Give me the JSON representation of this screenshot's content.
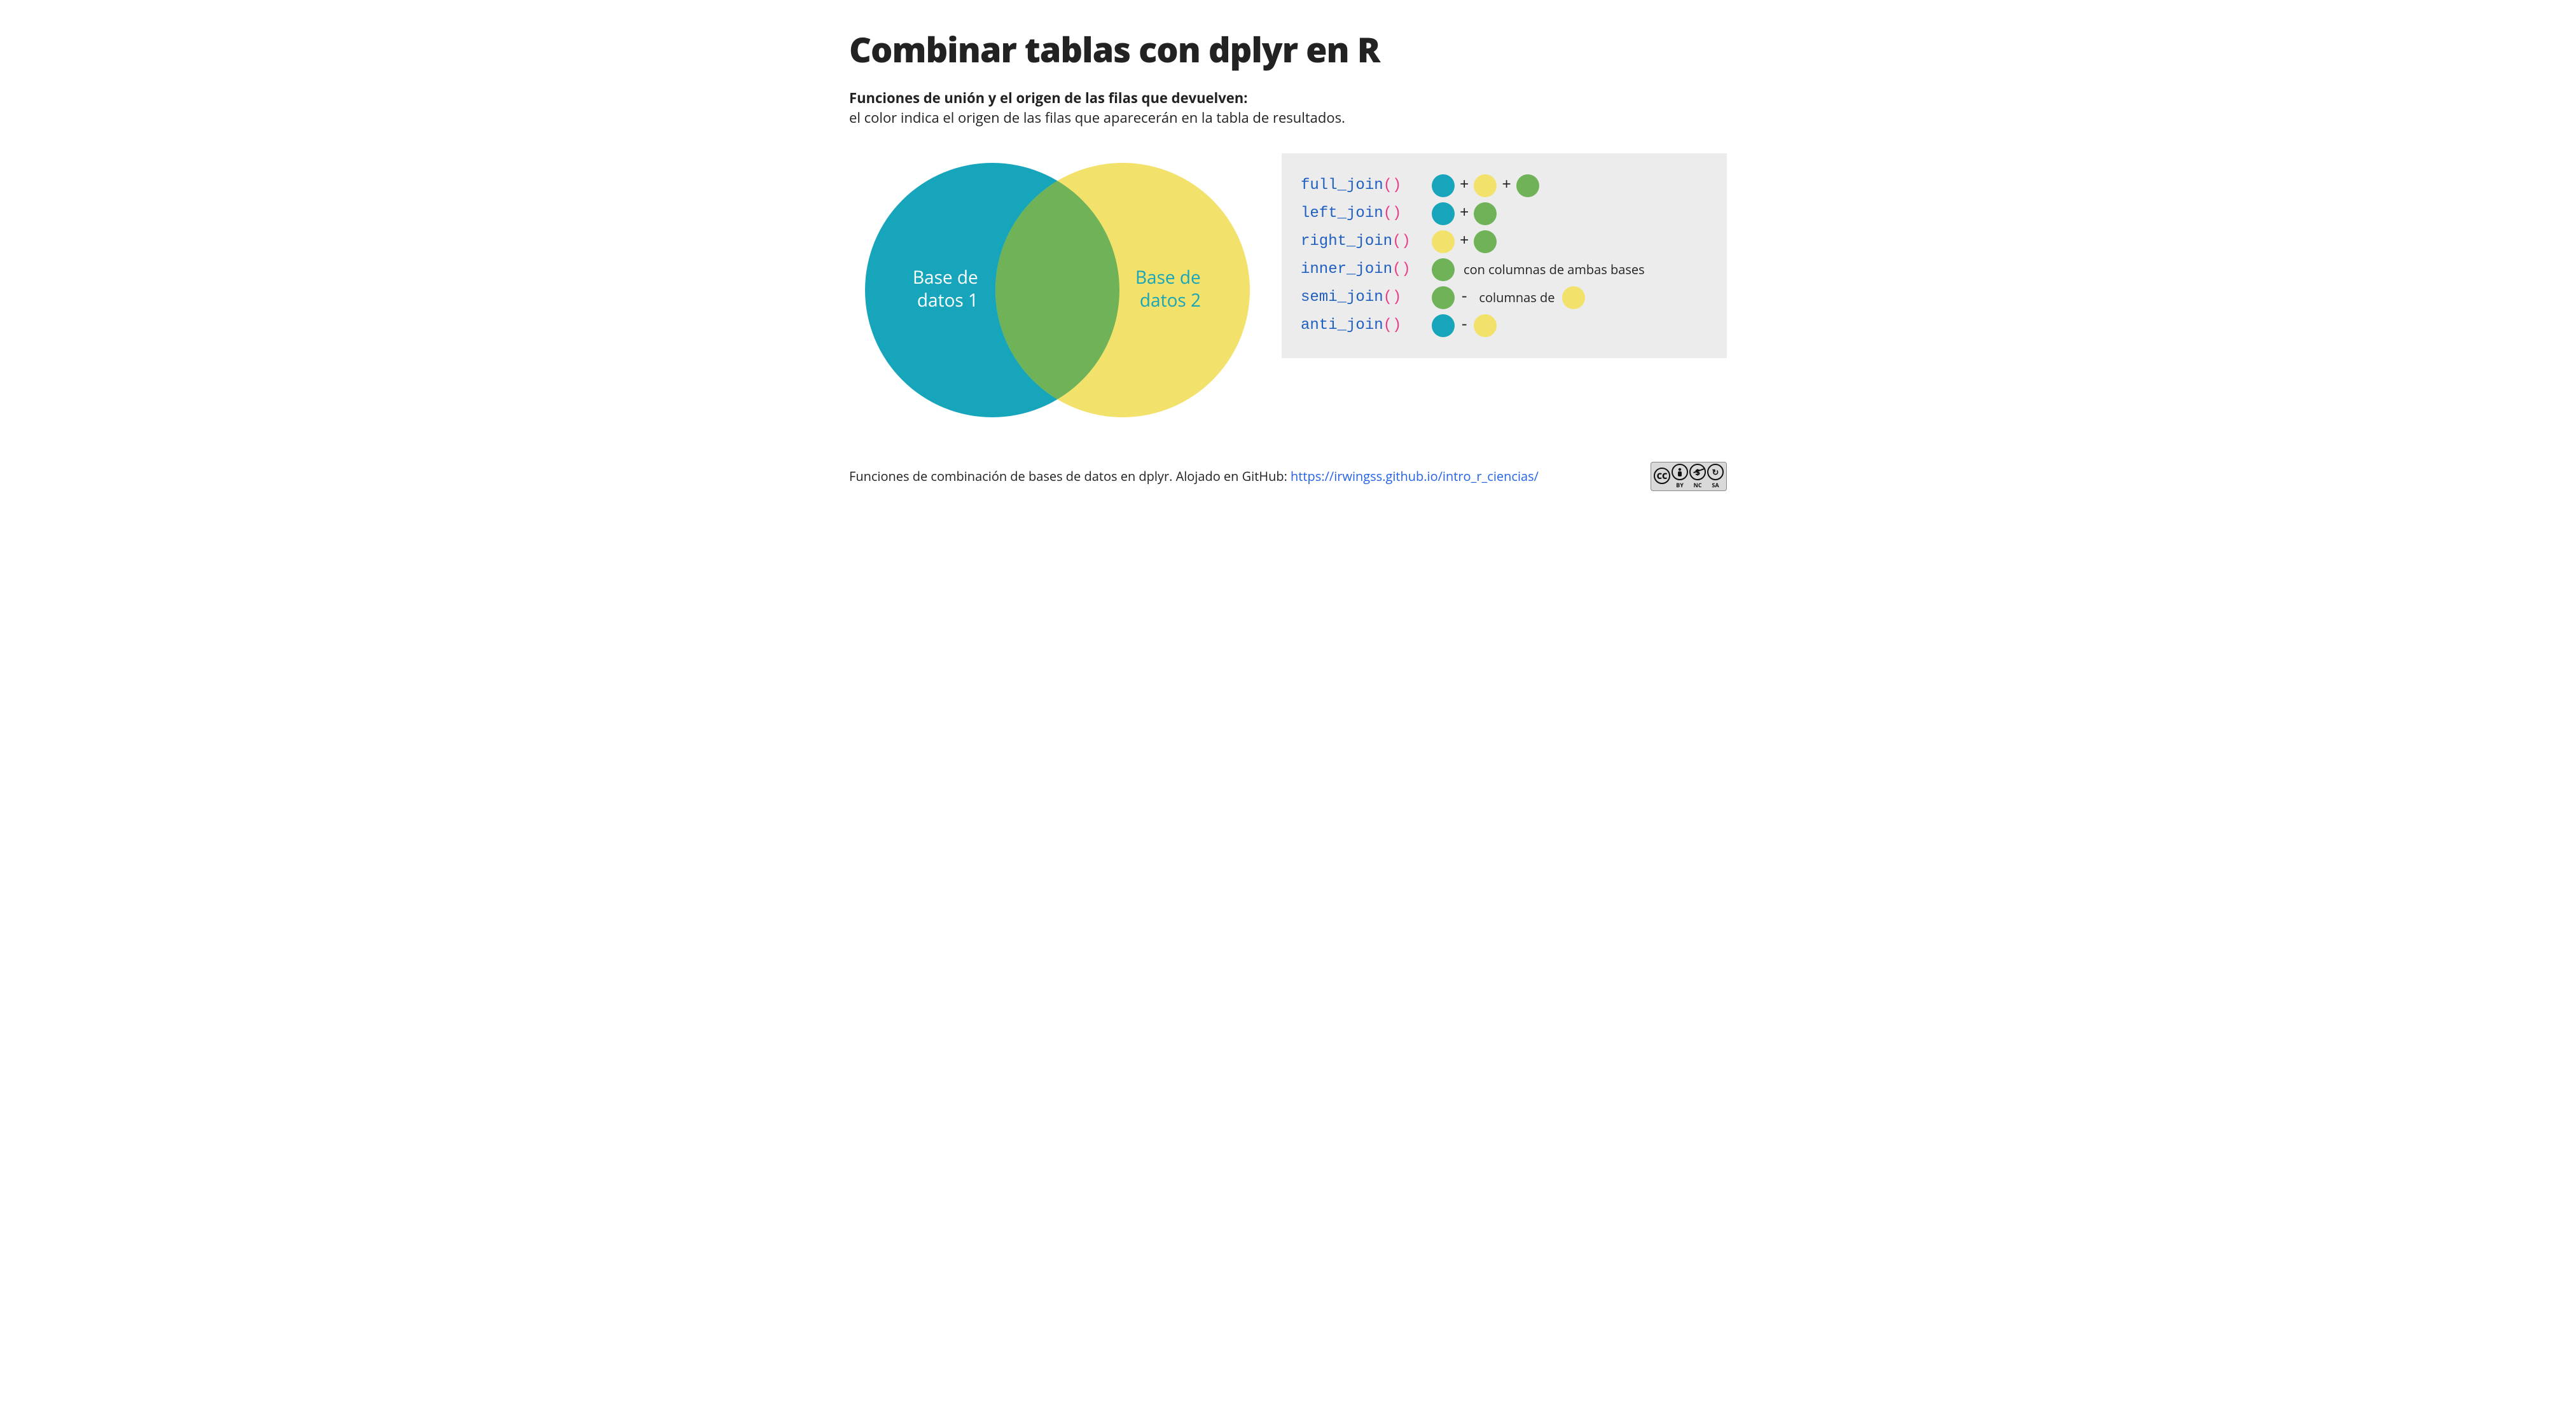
{
  "title": "Combinar tablas con dplyr en R",
  "subtitle_bold": "Funciones de unión y el origen de las filas que devuelven:",
  "subtitle_rest": "el color indica el origen de las filas que aparecerán en la tabla de resultados.",
  "venn": {
    "label1_line1": "Base de",
    "label1_line2": "datos 1",
    "label2_line1": "Base de",
    "label2_line2": "datos 2"
  },
  "colors": {
    "teal": "#17a5bb",
    "yellow": "#f2e16a",
    "green": "#6fb257",
    "code_fn": "#1f5fbf",
    "code_paren": "#e83e8c",
    "legend_bg": "#ececec",
    "link": "#2563eb"
  },
  "legend": [
    {
      "fn": "full_join",
      "tokens": [
        "teal",
        "+",
        "yellow",
        "+",
        "green"
      ]
    },
    {
      "fn": "left_join",
      "tokens": [
        "teal",
        "+",
        "green"
      ]
    },
    {
      "fn": "right_join",
      "tokens": [
        "yellow",
        "+",
        "green"
      ]
    },
    {
      "fn": "inner_join",
      "tokens": [
        "green"
      ],
      "note_after": "con columnas de ambas bases"
    },
    {
      "fn": "semi_join",
      "tokens": [
        "green",
        "-"
      ],
      "note_after": "columnas de",
      "trailing_dot": "yellow"
    },
    {
      "fn": "anti_join",
      "tokens": [
        "teal",
        "-",
        "yellow"
      ]
    }
  ],
  "paren": "()",
  "footer": {
    "text_before_link": "Funciones de combinación de bases de datos en dplyr.  Alojado en GitHub: ",
    "link_text": "https://irwingss.github.io/intro_r_ciencias/",
    "license_labels": [
      "CC",
      "BY",
      "NC",
      "SA"
    ],
    "license_glyphs": [
      "CC",
      "🄯",
      "$",
      "⟳"
    ]
  }
}
